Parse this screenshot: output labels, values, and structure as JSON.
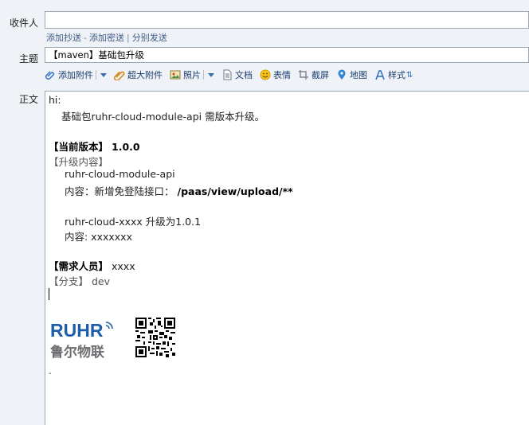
{
  "to": {
    "label": "收件人",
    "value": ""
  },
  "links": {
    "add_cc": "添加抄送",
    "dash": "-",
    "add_bcc": "添加密送",
    "pipe": "|",
    "separate_send": "分别发送"
  },
  "subject": {
    "label": "主题",
    "value": "【maven】基础包升级"
  },
  "toolbar": {
    "attach": "添加附件",
    "large_attach": "超大附件",
    "photo": "照片",
    "doc": "文档",
    "emoji": "表情",
    "screenshot": "截屏",
    "map": "地图",
    "style": "样式"
  },
  "body": {
    "label": "正文",
    "greeting": "hi:",
    "intro": "基础包ruhr-cloud-module-api 需版本升级。",
    "current_version_label": "【当前版本】",
    "current_version_value": "1.0.0",
    "upgrade_label": "【升级内容】",
    "module1": "ruhr-cloud-module-api",
    "module1_content_label": "内容：新增免登陆接口：",
    "module1_content_value": "/paas/view/upload/**",
    "module2": "ruhr-cloud-xxxx  升级为1.0.1",
    "module2_content": "内容: xxxxxxx",
    "requester_label": "【需求人员】",
    "requester_value": "xxxx",
    "branch_label": "【分支】",
    "branch_value": "dev"
  },
  "signature": {
    "logo_text": "RUHR",
    "logo_sub": "鲁尔物联",
    "dash": "-"
  },
  "colors": {
    "background": "#eff2f6",
    "link": "#3b5a86",
    "logo_blue": "#1f5da8",
    "logo_gray": "#6d6e71"
  }
}
